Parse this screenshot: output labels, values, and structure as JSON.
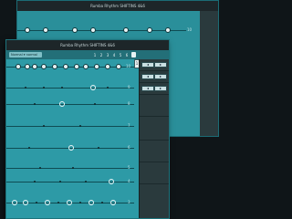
{
  "back_window": {
    "title": "Rumba Rhythm SHIFTINS 4&6",
    "lane_label": "10"
  },
  "front_window": {
    "title": "Rumba Rhythm SHIFTINS 4&6",
    "menu_label": "Normal ▾ normal",
    "toolbar_icons": [
      "1",
      "2",
      "3",
      "4",
      "5",
      "6"
    ],
    "lane_labels": [
      "10",
      "9",
      "8",
      "7",
      "6",
      "5",
      "4",
      "3"
    ],
    "panel_buttons": [
      "◂",
      "▸",
      "◂",
      "▸",
      "◂",
      "▸"
    ],
    "scroll_label": "1"
  },
  "colors": {
    "window_bg": "#2d9aa6",
    "titlebar": "#1d2629",
    "panel": "#2a3a3d",
    "node": "#e8f3f4"
  }
}
